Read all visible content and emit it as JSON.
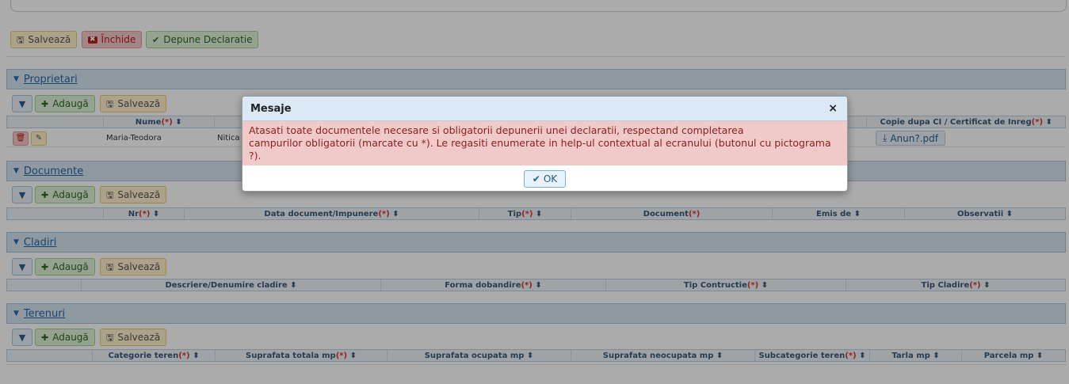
{
  "toolbar": {
    "save": "Salvează",
    "close": "Închide",
    "submit": "Depune Declaratie"
  },
  "common": {
    "add": "Adaugă",
    "save": "Salvează"
  },
  "sections": {
    "proprietari": {
      "title": "Proprietari",
      "headers": {
        "nume": "Nume",
        "nume_req": "(*)",
        "nume_sort": "⬍",
        "copie": "Copie dupa CI / Certificat de Inreg",
        "copie_req": "(*)",
        "copie_sort": "⬍"
      },
      "row": {
        "nume": "Maria-Teodora",
        "prenume": "Nitica",
        "file": "Anun?.pdf"
      }
    },
    "documente": {
      "title": "Documente",
      "headers": [
        "Nr",
        "Data document/Impunere",
        "Tip",
        "Document",
        "Emis de",
        "Observatii"
      ],
      "required": [
        true,
        true,
        true,
        true,
        false,
        false
      ],
      "sortable": [
        true,
        true,
        true,
        false,
        true,
        true
      ]
    },
    "cladiri": {
      "title": "Cladiri",
      "headers": [
        "Descriere/Denumire cladire",
        "Forma dobandire",
        "Tip Contructie",
        "Tip Cladire"
      ],
      "required": [
        false,
        true,
        true,
        true
      ],
      "sortable": [
        true,
        true,
        true,
        true
      ]
    },
    "terenuri": {
      "title": "Terenuri",
      "headers": [
        "Categorie teren",
        "Suprafata totala mp",
        "Suprafata ocupata mp",
        "Suprafata neocupata mp",
        "Subcategorie teren",
        "Tarla mp",
        "Parcela mp"
      ],
      "required": [
        true,
        true,
        false,
        false,
        true,
        false,
        false
      ],
      "sortable": [
        true,
        true,
        true,
        true,
        true,
        true,
        true
      ]
    }
  },
  "modal": {
    "title": "Mesaje",
    "close": "×",
    "message_line1": "Atasati toate documentele necesare si obligatorii depunerii unei declaratii, respectand completarea",
    "message_line2": "campurilor obligatorii (marcate cu *). Le regasiti enumerate in help-ul contextual al ecranului (butonul cu pictograma ?).",
    "ok": "OK"
  },
  "colors": {
    "section_bg": "#d6e4f1",
    "link": "#2a68a8",
    "error_bg": "#f0c9c9"
  },
  "icons": {
    "save": "floppy-icon",
    "close": "x-square-icon",
    "check": "check-icon",
    "filter": "filter-icon",
    "plus": "plus-icon",
    "download": "download-icon",
    "caret": "caret-down-icon"
  }
}
